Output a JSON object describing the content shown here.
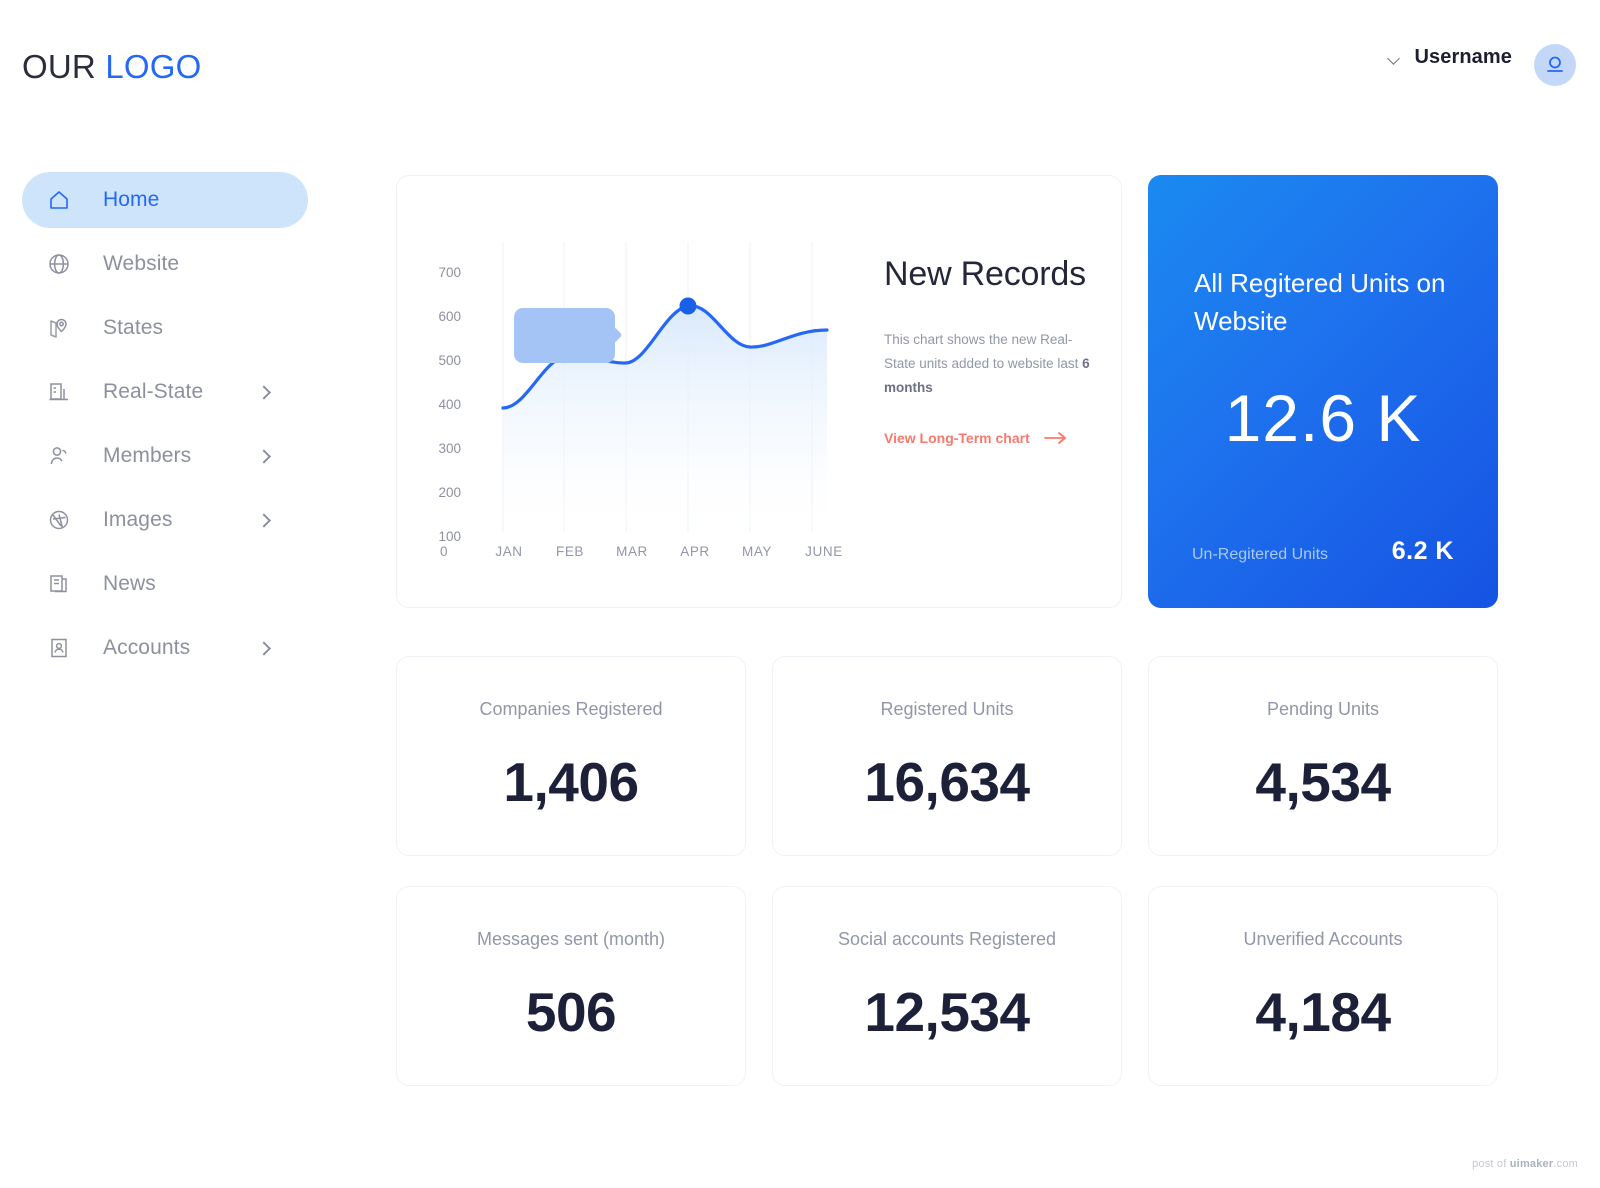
{
  "header": {
    "logo_primary": "OUR",
    "logo_accent": "LOGO",
    "username": "Username",
    "chevron_icon": "chevron-down-icon",
    "avatar_icon": "user-avatar-icon"
  },
  "sidebar": {
    "items": [
      {
        "label": "Home",
        "icon": "home-icon",
        "active": true,
        "has_arrow": false
      },
      {
        "label": "Website",
        "icon": "globe-icon",
        "active": false,
        "has_arrow": false
      },
      {
        "label": "States",
        "icon": "map-pin-icon",
        "active": false,
        "has_arrow": false
      },
      {
        "label": "Real-State",
        "icon": "building-icon",
        "active": false,
        "has_arrow": true
      },
      {
        "label": "Members",
        "icon": "users-icon",
        "active": false,
        "has_arrow": true
      },
      {
        "label": "Images",
        "icon": "aperture-icon",
        "active": false,
        "has_arrow": true
      },
      {
        "label": "News",
        "icon": "news-icon",
        "active": false,
        "has_arrow": false
      },
      {
        "label": "Accounts",
        "icon": "id-card-icon",
        "active": false,
        "has_arrow": true
      }
    ]
  },
  "chart_card": {
    "title": "New Records",
    "description_pre": "This chart shows the new Real-State units added to website last ",
    "description_bold": "6 months",
    "link_label": "View Long-Term chart",
    "link_icon": "arrow-right-icon",
    "link_color": "#f9796c",
    "tooltip_visible": true
  },
  "chart_data": {
    "type": "area",
    "title": "New Records",
    "xlabel": "",
    "ylabel": "",
    "categories": [
      "JAN",
      "FEB",
      "MAR",
      "APR",
      "MAY",
      "JUNE"
    ],
    "values": [
      300,
      425,
      408,
      545,
      452,
      490
    ],
    "series": [
      {
        "name": "New Real-State units",
        "values": [
          300,
          425,
          408,
          545,
          452,
          490
        ]
      }
    ],
    "y_ticks": [
      "0",
      "100",
      "200",
      "300",
      "400",
      "500",
      "600",
      "700"
    ],
    "x_origin_label": "0",
    "ylim": [
      0,
      700
    ],
    "grid": "vertical",
    "legend": "none",
    "highlight_point": {
      "category": "APR",
      "value": 545
    },
    "line_color": "#2568f6",
    "area_fill": "#e8f1fd",
    "tooltip_color": "#a5c4f6"
  },
  "blue_card": {
    "title": "All Regitered Units on Website",
    "value": "12.6 K",
    "footer_label": "Un-Regitered Units",
    "footer_value": "6.2 K",
    "gradient_from": "#1a8af0",
    "gradient_to": "#1653e3"
  },
  "stats": [
    {
      "label": "Companies Registered",
      "value": "1,406"
    },
    {
      "label": "Registered Units",
      "value": "16,634"
    },
    {
      "label": "Pending Units",
      "value": "4,534"
    },
    {
      "label": "Messages sent (month)",
      "value": "506"
    },
    {
      "label": "Social accounts Registered",
      "value": "12,534"
    },
    {
      "label": "Unverified Accounts",
      "value": "4,184"
    }
  ],
  "footer": {
    "watermark_pre": "post of ",
    "watermark_brand": "uimaker",
    "watermark_post": ".com"
  }
}
